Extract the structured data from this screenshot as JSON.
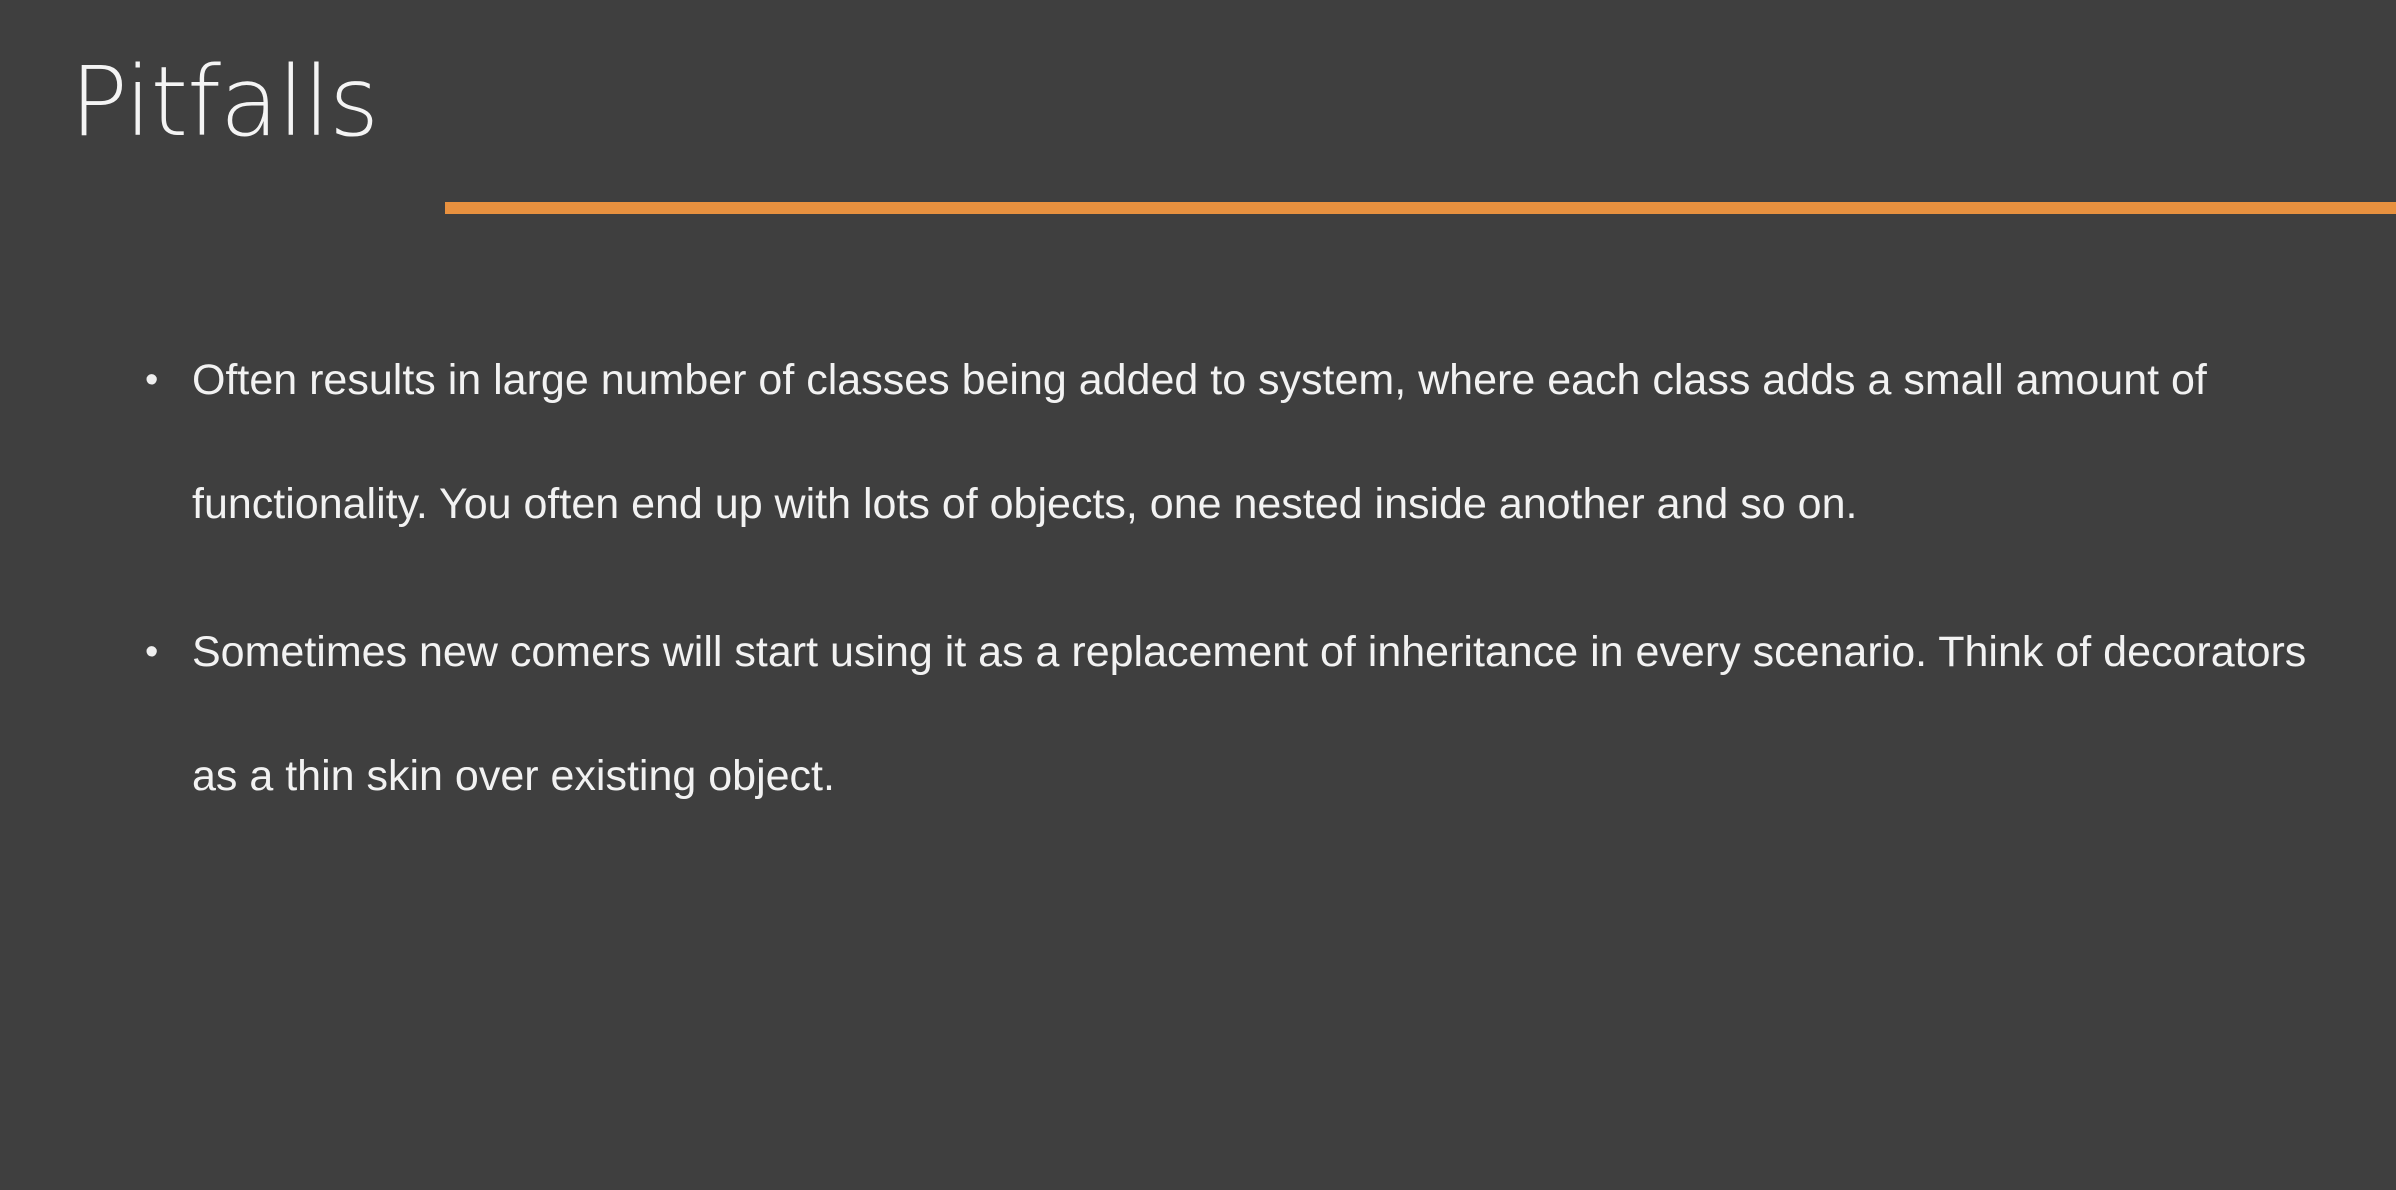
{
  "slide": {
    "title": "Pitfalls",
    "accent_color": "#e8913f",
    "background_color": "#3f3f3f",
    "bullets": [
      {
        "marker": "•",
        "text": "Often results in large number of classes being added to system, where each class adds a small amount of functionality. You often end up with lots of objects, one nested inside another and so on."
      },
      {
        "marker": "•",
        "text": "Sometimes new comers will start using it as a replacement of inheritance in every scenario. Think of decorators as a thin skin over existing object."
      }
    ]
  }
}
